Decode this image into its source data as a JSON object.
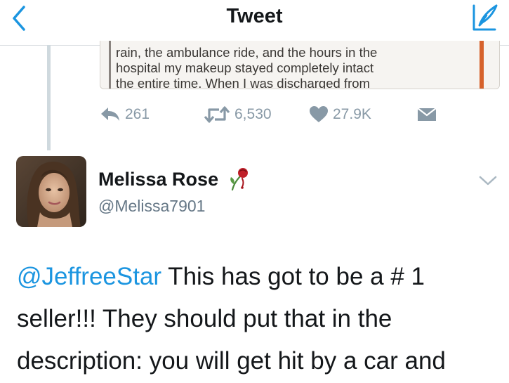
{
  "header": {
    "title": "Tweet",
    "accent_color": "#1b95e0"
  },
  "quoted_image": {
    "lines": [
      "rain, the ambulance ride, and the hours in the",
      "hospital my makeup stayed completely intact",
      "the entire time. When I was discharged from"
    ]
  },
  "actions": {
    "reply_count": "261",
    "retweet_count": "6,530",
    "like_count": "27.9K",
    "icons": [
      "reply-icon",
      "retweet-icon",
      "like-icon",
      "direct-message-icon"
    ]
  },
  "author": {
    "name": "Melissa Rose",
    "handle": "@Melissa7901"
  },
  "tweet": {
    "mention": "@JeffreeStar",
    "line1_rest": " This has got to be a # 1",
    "line2": "seller!!! They should put that in the",
    "line3": "description: you will get hit by a car and"
  }
}
